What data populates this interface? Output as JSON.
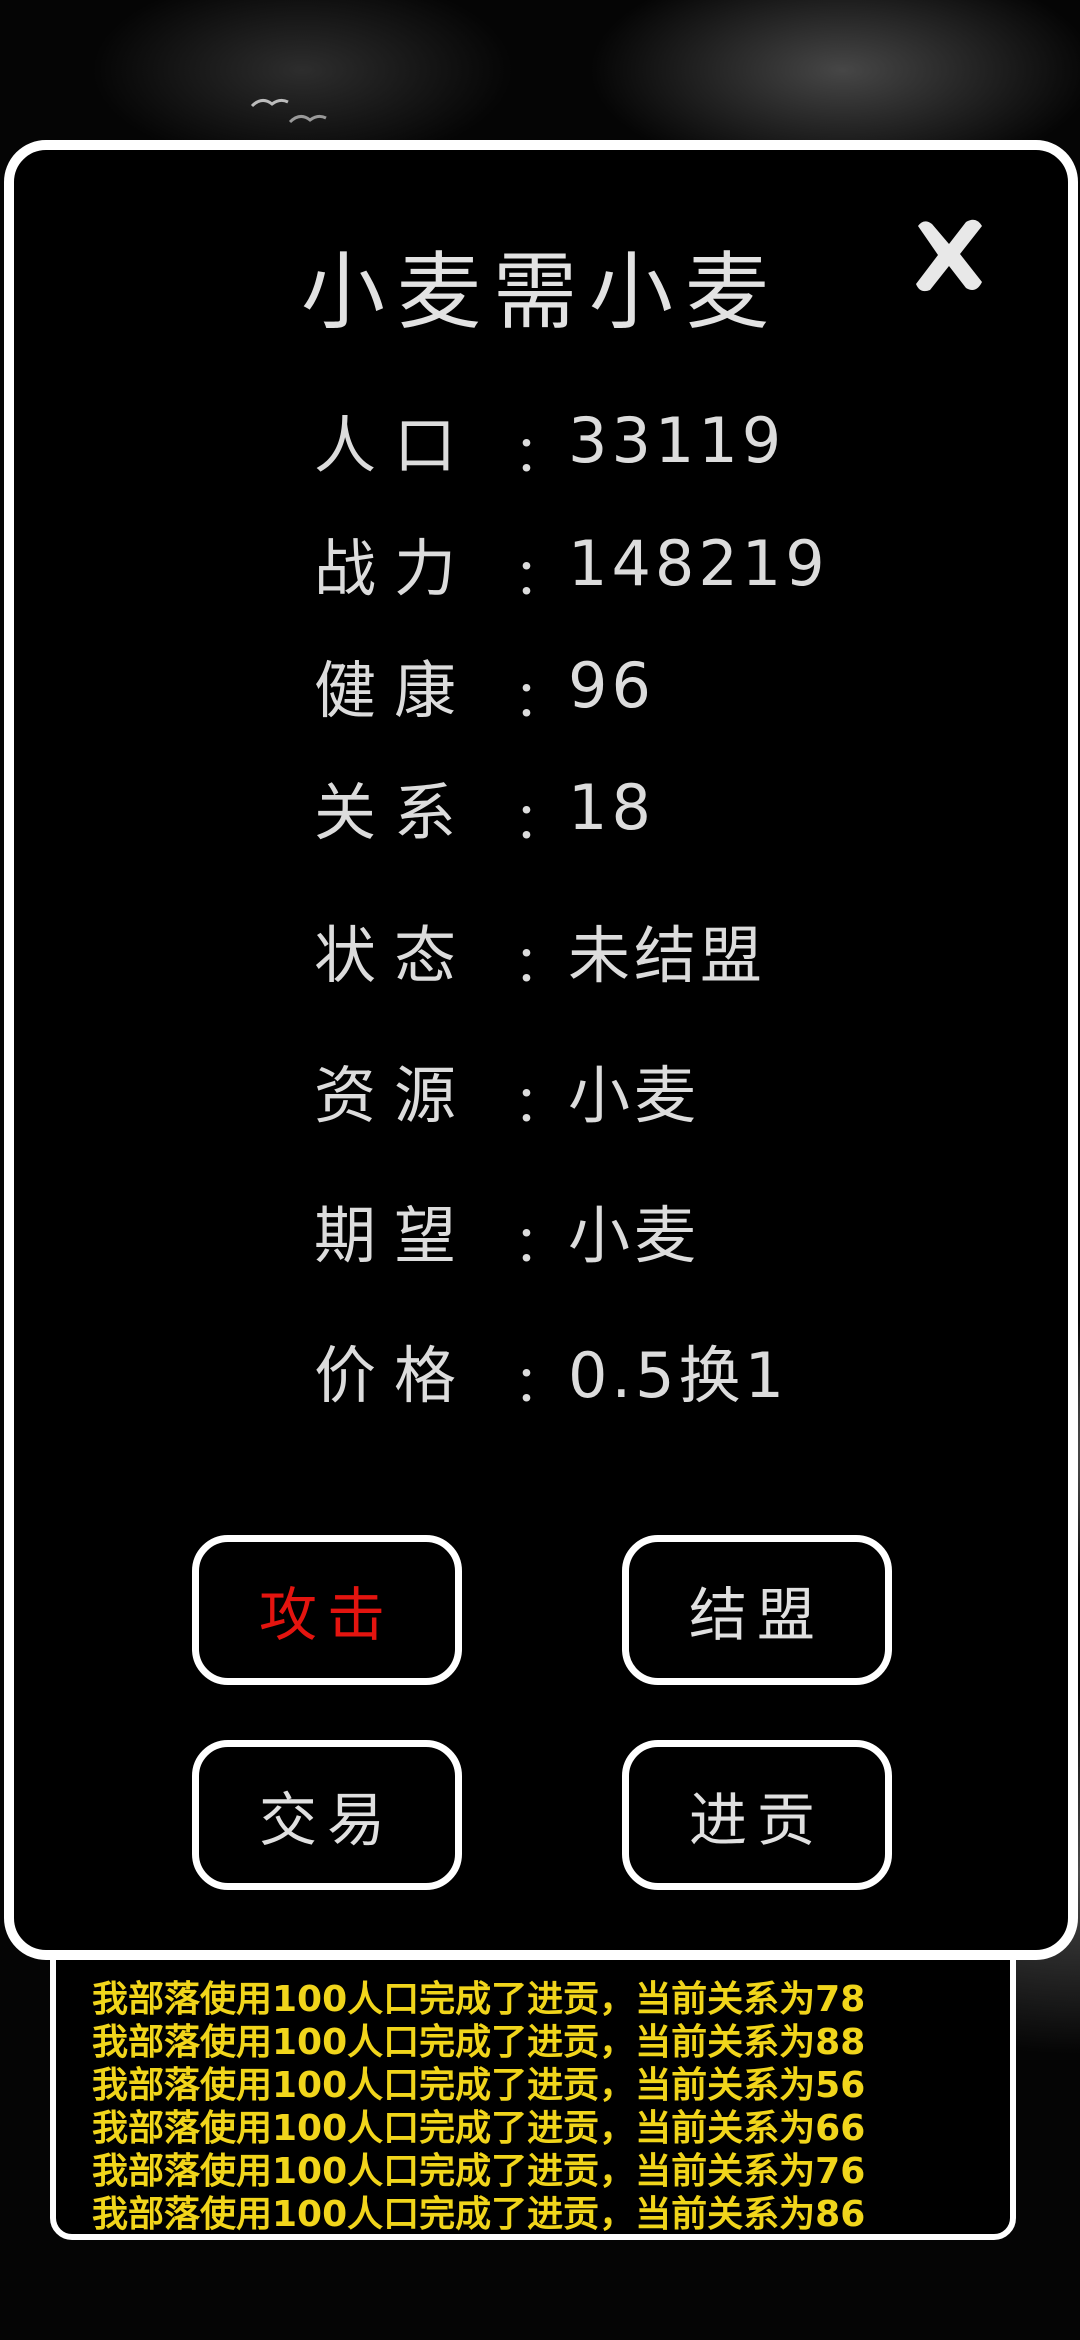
{
  "dialog": {
    "title": "小麦需小麦",
    "colon": "：",
    "stats": [
      {
        "label": "人口",
        "value": "33119"
      },
      {
        "label": "战力",
        "value": "148219"
      },
      {
        "label": "健康",
        "value": "96"
      },
      {
        "label": "关系",
        "value": "18"
      },
      {
        "label": "状态",
        "value": "未结盟"
      },
      {
        "label": "资源",
        "value": "小麦"
      },
      {
        "label": "期望",
        "value": "小麦"
      },
      {
        "label": "价格",
        "value": "0.5换1"
      }
    ],
    "buttons": {
      "attack": "攻击",
      "alliance": "结盟",
      "trade": "交易",
      "tribute": "进贡"
    },
    "close_icon": "close-x-icon"
  },
  "log": {
    "lines": [
      "我部落使用100人口完成了进贡，当前关系为78",
      "我部落使用100人口完成了进贡，当前关系为88",
      "我部落使用100人口完成了进贡，当前关系为56",
      "我部落使用100人口完成了进贡，当前关系为66",
      "我部落使用100人口完成了进贡，当前关系为76",
      "我部落使用100人口完成了进贡，当前关系为86"
    ]
  },
  "colors": {
    "attack_text": "#e4140f",
    "log_text": "#f1d51b",
    "border": "#ffffff"
  }
}
